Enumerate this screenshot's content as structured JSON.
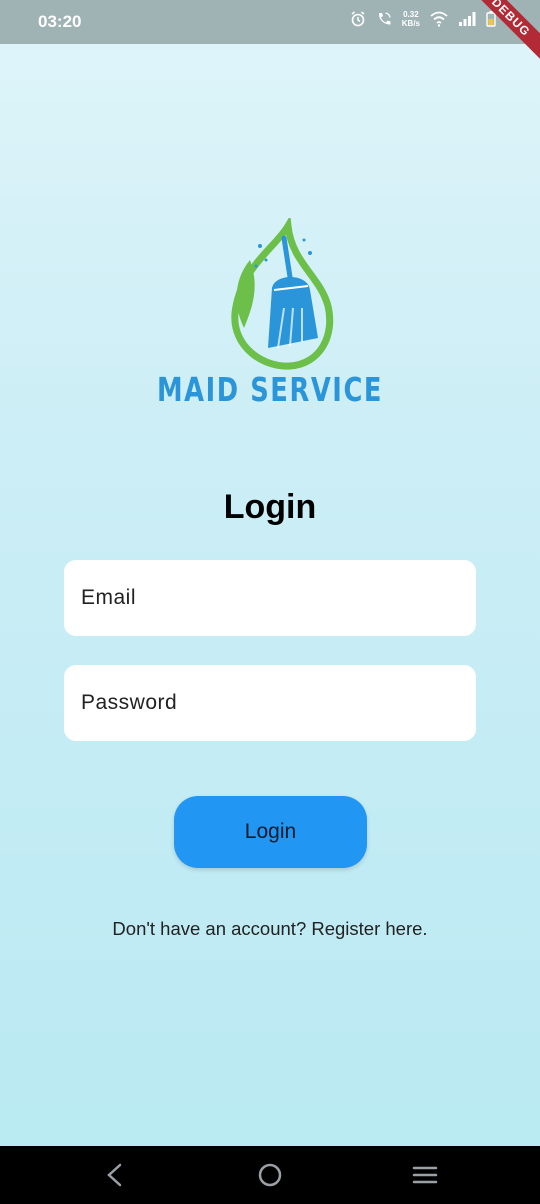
{
  "status_bar": {
    "time": "03:20",
    "net_speed_value": "0.32",
    "net_speed_unit": "KB/s",
    "icons": [
      "alarm-icon",
      "call-icon",
      "wifi-icon",
      "signal-icon",
      "battery-icon"
    ]
  },
  "debug_banner": "DEBUG",
  "brand": {
    "name": "MAID SERVICE",
    "primary_color": "#2a95d9",
    "leaf_color": "#6cc04a"
  },
  "login_form": {
    "title": "Login",
    "email_placeholder": "Email",
    "password_placeholder": "Password",
    "submit_label": "Login",
    "submit_color": "#2196f3",
    "register_text": "Don't have an account? Register here."
  },
  "nav_bar": {
    "icons": [
      "back-icon",
      "home-icon",
      "menu-icon"
    ]
  }
}
